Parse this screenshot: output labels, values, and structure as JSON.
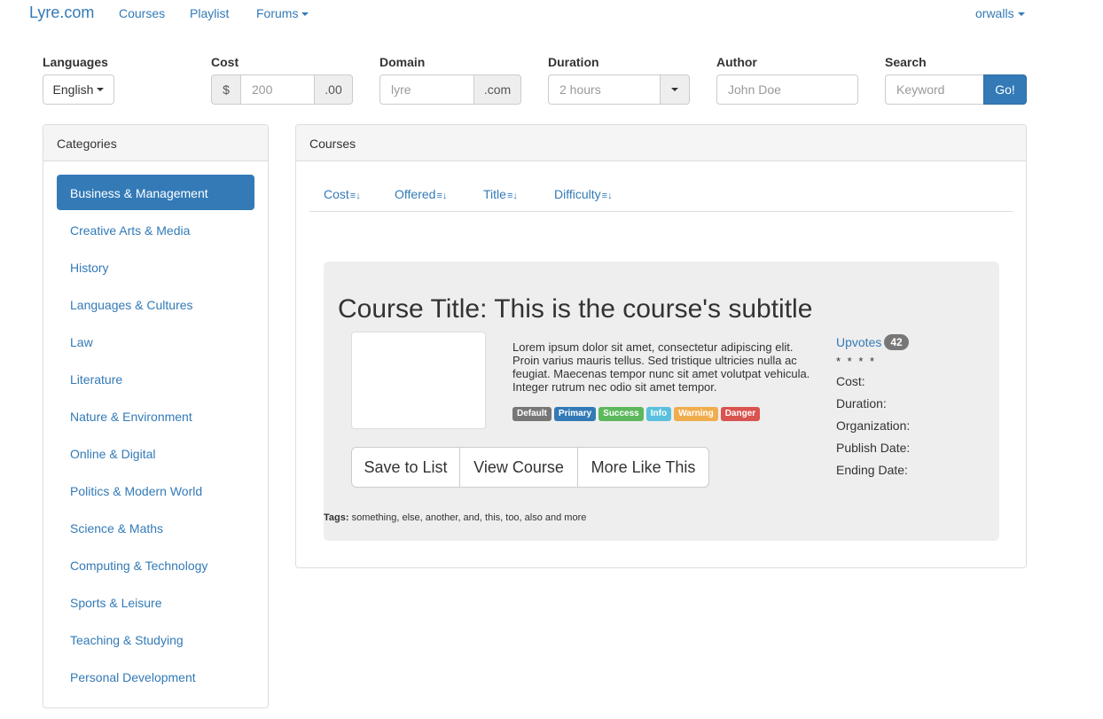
{
  "nav": {
    "brand": "Lyre.com",
    "courses": "Courses",
    "playlist": "Playlist",
    "forums": "Forums",
    "user": "orwalls"
  },
  "filters": {
    "languages": {
      "label": "Languages",
      "value": "English"
    },
    "cost": {
      "label": "Cost",
      "prefix": "$",
      "placeholder": "200",
      "suffix": ".00"
    },
    "domain": {
      "label": "Domain",
      "placeholder": "lyre",
      "suffix": ".com"
    },
    "duration": {
      "label": "Duration",
      "value": "2 hours"
    },
    "author": {
      "label": "Author",
      "placeholder": "John Doe"
    },
    "search": {
      "label": "Search",
      "placeholder": "Keyword",
      "button": "Go!"
    }
  },
  "categories": {
    "heading": "Categories",
    "items": [
      "Business & Management",
      "Creative Arts & Media",
      "History",
      "Languages & Cultures",
      "Law",
      "Literature",
      "Nature & Environment",
      "Online & Digital",
      "Politics & Modern World",
      "Science & Maths",
      "Computing & Technology",
      "Sports & Leisure",
      "Teaching & Studying",
      "Personal Development"
    ],
    "active_index": 0
  },
  "courses": {
    "heading": "Courses",
    "sort": [
      "Cost",
      "Offered",
      "Title",
      "Difficulty"
    ],
    "course": {
      "title": "Course Title: This is the course's subtitle",
      "description": "Lorem ipsum dolor sit amet, consectetur adipiscing elit. Proin varius mauris tellus. Sed tristique ultricies nulla ac feugiat. Maecenas tempor nunc sit amet volutpat vehicula. Integer rutrum nec odio sit amet tempor.",
      "labels": [
        {
          "text": "Default",
          "color": "#777777"
        },
        {
          "text": "Primary",
          "color": "#337ab7"
        },
        {
          "text": "Success",
          "color": "#5cb85c"
        },
        {
          "text": "Info",
          "color": "#5bc0de"
        },
        {
          "text": "Warning",
          "color": "#f0ad4e"
        },
        {
          "text": "Danger",
          "color": "#d9534f"
        }
      ],
      "buttons": [
        "Save to List",
        "View Course",
        "More Like This"
      ],
      "tags_label": "Tags:",
      "tags": "something, else, another, and, this, too, also and more",
      "upvotes_label": "Upvotes",
      "upvotes_count": "42",
      "stars": "* * * *",
      "meta": [
        "Cost:",
        "Duration:",
        "Organization:",
        "Publish Date:",
        "Ending Date:"
      ]
    }
  },
  "colors": {
    "accent": "#337ab7",
    "panel_bg": "#f5f5f5",
    "jumbotron_bg": "#eeeeee"
  }
}
